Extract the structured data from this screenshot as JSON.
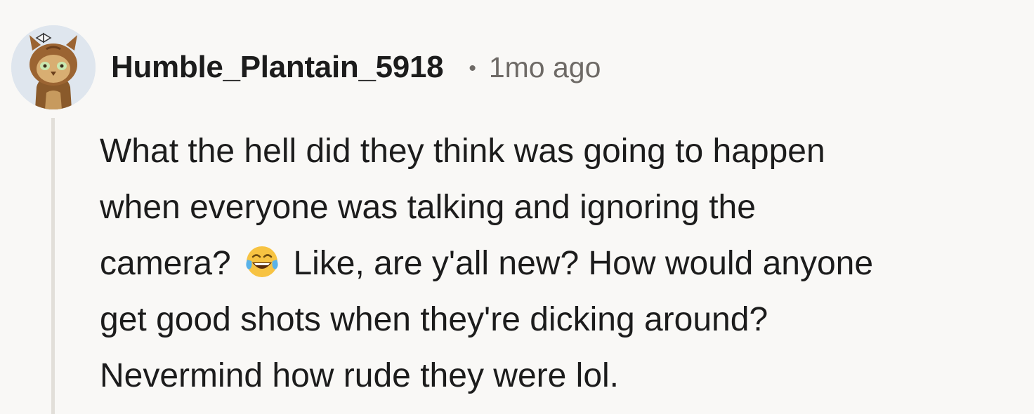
{
  "comment": {
    "username": "Humble_Plantain_5918",
    "separator": "•",
    "timestamp": "1mo ago",
    "avatar_icon": "owl-costume-avatar-icon",
    "body": {
      "line1": "What the hell did they think was going to happen",
      "line2": "when everyone was talking and ignoring the",
      "line3_before_emoji": "camera?",
      "emoji_icon": "face-with-tears-of-joy-icon",
      "line3_after_emoji": "Like, are y'all new? How would anyone",
      "line4": "get good shots when they're dicking around?",
      "line5": "Nevermind how rude they were lol."
    }
  },
  "colors": {
    "background": "#f9f8f6",
    "text": "#1c1c1c",
    "meta_text": "#6e6a66",
    "thread_line": "#e2dfd9",
    "emoji_face": "#f7c342",
    "emoji_tears": "#59b2e8"
  }
}
